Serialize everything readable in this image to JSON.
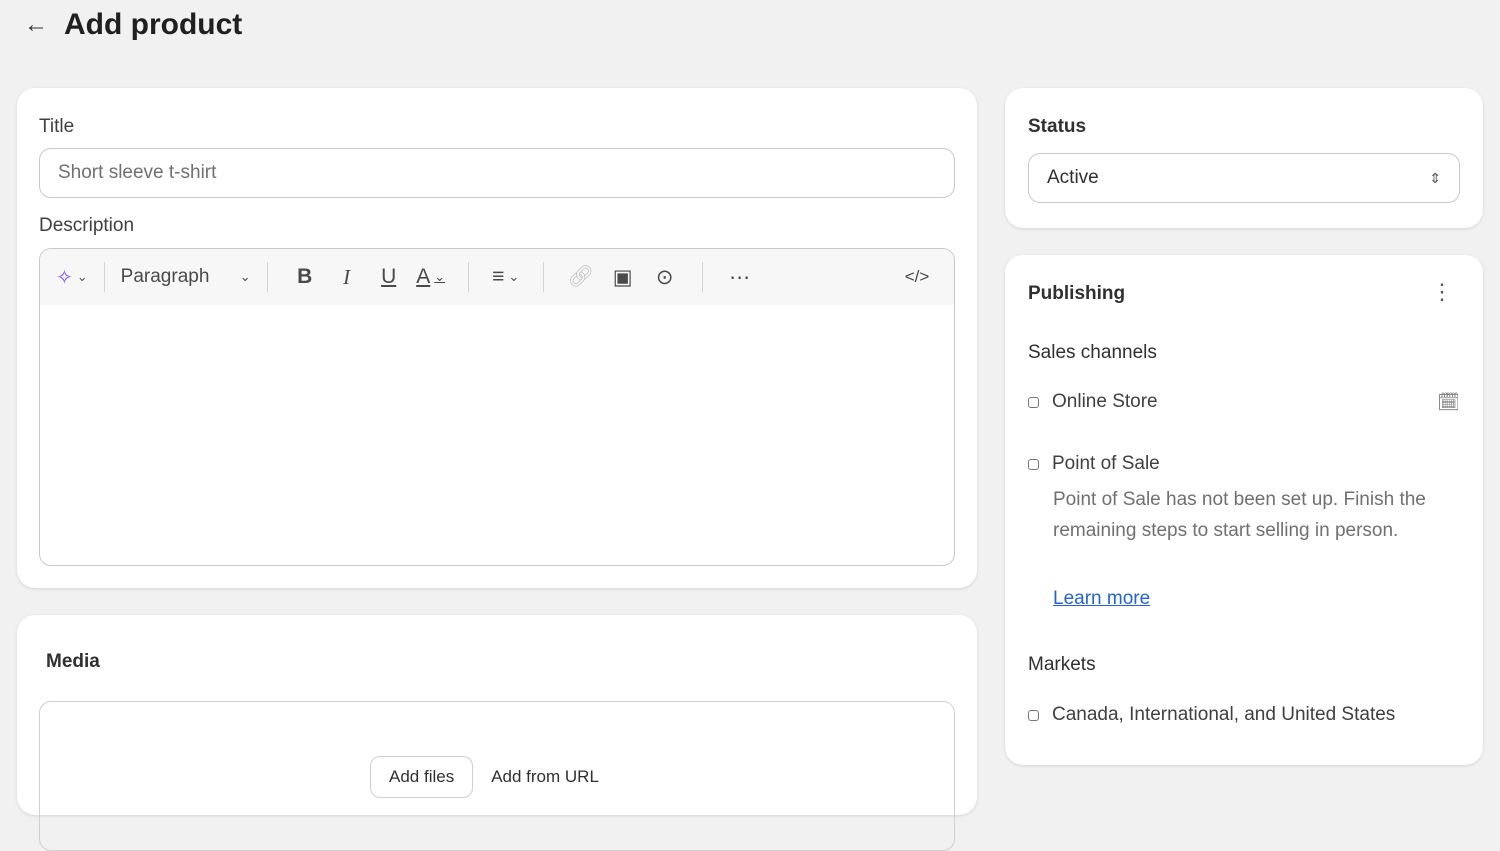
{
  "header": {
    "title": "Add product"
  },
  "product": {
    "title_label": "Title",
    "title_placeholder": "Short sleeve t-shirt",
    "description_label": "Description",
    "toolbar": {
      "paragraph": "Paragraph"
    }
  },
  "media": {
    "title": "Media",
    "add_files": "Add files",
    "add_from_url": "Add from URL"
  },
  "status": {
    "label": "Status",
    "value": "Active"
  },
  "publishing": {
    "title": "Publishing",
    "sales_channels_label": "Sales channels",
    "channels": [
      {
        "name": "Online Store"
      },
      {
        "name": "Point of Sale",
        "note": "Point of Sale has not been set up. Finish the remaining steps to start selling in person.",
        "link": "Learn more"
      }
    ],
    "markets_label": "Markets",
    "markets_value": "Canada, International, and United States"
  }
}
